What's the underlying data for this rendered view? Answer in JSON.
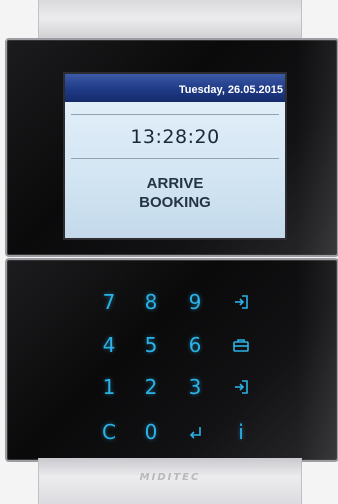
{
  "screen": {
    "date": "Tuesday, 26.05.2015",
    "time": "13:28:20",
    "status_line1": "ARRIVE",
    "status_line2": "BOOKING"
  },
  "keypad": {
    "row1": [
      "7",
      "8",
      "9"
    ],
    "row2": [
      "4",
      "5",
      "6"
    ],
    "row3": [
      "1",
      "2",
      "3"
    ],
    "row4": [
      "C",
      "0"
    ],
    "function_key_i": "i",
    "icons": [
      "login-arrow-icon",
      "briefcase-icon",
      "login-arrow-icon",
      "enter-return-icon"
    ]
  },
  "brand": "MIDITEC",
  "colors": {
    "key_glow": "#2bb2e8",
    "screen_header": "#1f3a86",
    "lcd_background": "#d4e6f3"
  }
}
